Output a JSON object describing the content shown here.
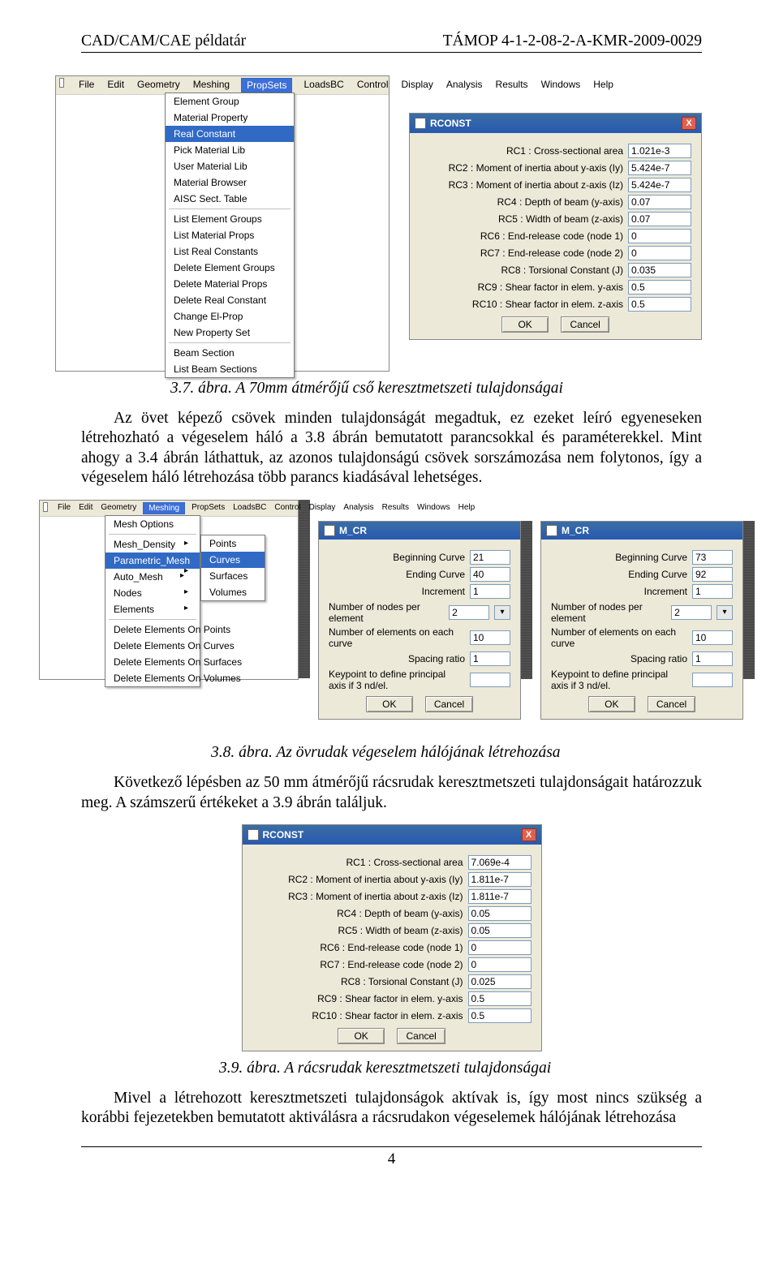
{
  "header": {
    "left": "CAD/CAM/CAE példatár",
    "right": "TÁMOP 4-1-2-08-2-A-KMR-2009-0029"
  },
  "menubar": [
    "File",
    "Edit",
    "Geometry",
    "Meshing",
    "PropSets",
    "LoadsBC",
    "Control",
    "Display",
    "Analysis",
    "Results",
    "Windows",
    "Help"
  ],
  "propsets_menu": {
    "g1": [
      "Element Group",
      "Material Property",
      "Real Constant",
      "Pick Material Lib",
      "User Material Lib",
      "Material Browser",
      "AISC Sect. Table"
    ],
    "g2": [
      "List Element Groups",
      "List Material Props",
      "List Real Constants",
      "Delete Element Groups",
      "Delete Material Props",
      "Delete Real Constant",
      "Change El-Prop",
      "New Property Set"
    ],
    "g3": [
      "Beam Section",
      "List Beam Sections"
    ],
    "selected": "Real Constant"
  },
  "rconst1": {
    "title": "RCONST",
    "rows": [
      {
        "label": "RC1 : Cross-sectional area",
        "val": "1.021e-3"
      },
      {
        "label": "RC2 : Moment of inertia about y-axis (Iy)",
        "val": "5.424e-7"
      },
      {
        "label": "RC3 : Moment of inertia about z-axis (Iz)",
        "val": "5.424e-7"
      },
      {
        "label": "RC4 : Depth of beam (y-axis)",
        "val": "0.07"
      },
      {
        "label": "RC5 : Width of beam (z-axis)",
        "val": "0.07"
      },
      {
        "label": "RC6 : End-release code (node 1)",
        "val": "0"
      },
      {
        "label": "RC7 : End-release code (node 2)",
        "val": "0"
      },
      {
        "label": "RC8 : Torsional Constant (J)",
        "val": "0.035"
      },
      {
        "label": "RC9 : Shear factor in elem. y-axis",
        "val": "0.5"
      },
      {
        "label": "RC10 : Shear factor in elem. z-axis",
        "val": "0.5"
      }
    ],
    "ok": "OK",
    "cancel": "Cancel"
  },
  "cap37": "3.7. ábra. A 70mm átmérőjű cső keresztmetszeti tulajdonságai",
  "para1": "Az övet képező csövek minden tulajdonságát megadtuk, ez ezeket leíró egyeneseken létrehozható a végeselem háló a 3.8 ábrán bemutatott parancsokkal és paraméterekkel. Mint ahogy a 3.4 ábrán láthattuk, az azonos tulajdonságú csövek sorszámozása nem folytonos, így a végeselem háló létrehozása több parancs kiadásával lehetséges.",
  "meshing_menu": {
    "col1": [
      "Mesh Options",
      "Mesh_Density",
      "Parametric_Mesh",
      "Auto_Mesh",
      "Nodes",
      "Elements"
    ],
    "col1_sel": "Parametric_Mesh",
    "col1_sub": [
      "Mesh_Density",
      "Parametric_Mesh",
      "Auto_Mesh",
      "Nodes",
      "Elements"
    ],
    "col2": [
      "Points",
      "Curves",
      "Surfaces",
      "Volumes"
    ],
    "col2_sel": "Curves",
    "col3": [
      "Delete Elements On Points",
      "Delete Elements On Curves",
      "Delete Elements On Surfaces",
      "Delete Elements On Volumes"
    ]
  },
  "mcr_a": {
    "title": "M_CR",
    "rows": [
      {
        "label": "Beginning Curve",
        "val": "21"
      },
      {
        "label": "Ending Curve",
        "val": "40"
      },
      {
        "label": "Increment",
        "val": "1"
      },
      {
        "label": "Number of nodes per element",
        "val": "2",
        "combo": true
      },
      {
        "label": "Number of elements on each curve",
        "val": "10"
      },
      {
        "label": "Spacing ratio",
        "val": "1"
      },
      {
        "label": "Keypoint to define principal axis if 3 nd/el.",
        "val": ""
      }
    ],
    "ok": "OK",
    "cancel": "Cancel"
  },
  "mcr_b": {
    "title": "M_CR",
    "rows": [
      {
        "label": "Beginning Curve",
        "val": "73"
      },
      {
        "label": "Ending Curve",
        "val": "92"
      },
      {
        "label": "Increment",
        "val": "1"
      },
      {
        "label": "Number of nodes per element",
        "val": "2",
        "combo": true
      },
      {
        "label": "Number of elements on each curve",
        "val": "10"
      },
      {
        "label": "Spacing ratio",
        "val": "1"
      },
      {
        "label": "Keypoint to define principal axis if 3 nd/el.",
        "val": ""
      }
    ],
    "ok": "OK",
    "cancel": "Cancel"
  },
  "cap38": "3.8. ábra. Az övrudak végeselem hálójának létrehozása",
  "para2": "Következő lépésben az 50 mm átmérőjű rácsrudak keresztmetszeti tulajdonságait határozzuk meg. A számszerű értékeket a 3.9 ábrán találjuk.",
  "rconst2": {
    "title": "RCONST",
    "rows": [
      {
        "label": "RC1 : Cross-sectional area",
        "val": "7.069e-4"
      },
      {
        "label": "RC2 : Moment of inertia about y-axis (Iy)",
        "val": "1.811e-7"
      },
      {
        "label": "RC3 : Moment of inertia about z-axis (Iz)",
        "val": "1.811e-7"
      },
      {
        "label": "RC4 : Depth of beam (y-axis)",
        "val": "0.05"
      },
      {
        "label": "RC5 : Width of beam (z-axis)",
        "val": "0.05"
      },
      {
        "label": "RC6 : End-release code (node 1)",
        "val": "0"
      },
      {
        "label": "RC7 : End-release code (node 2)",
        "val": "0"
      },
      {
        "label": "RC8 : Torsional Constant (J)",
        "val": "0.025"
      },
      {
        "label": "RC9 : Shear factor in elem. y-axis",
        "val": "0.5"
      },
      {
        "label": "RC10 : Shear factor in elem. z-axis",
        "val": "0.5"
      }
    ],
    "ok": "OK",
    "cancel": "Cancel"
  },
  "cap39": "3.9. ábra. A rácsrudak keresztmetszeti tulajdonságai",
  "para3": "Mivel a létrehozott keresztmetszeti tulajdonságok aktívak is, így most nincs szükség a korábbi fejezetekben bemutatott aktiválásra a rácsrudakon végeselemek hálójának létrehozása",
  "pagenum": "4"
}
